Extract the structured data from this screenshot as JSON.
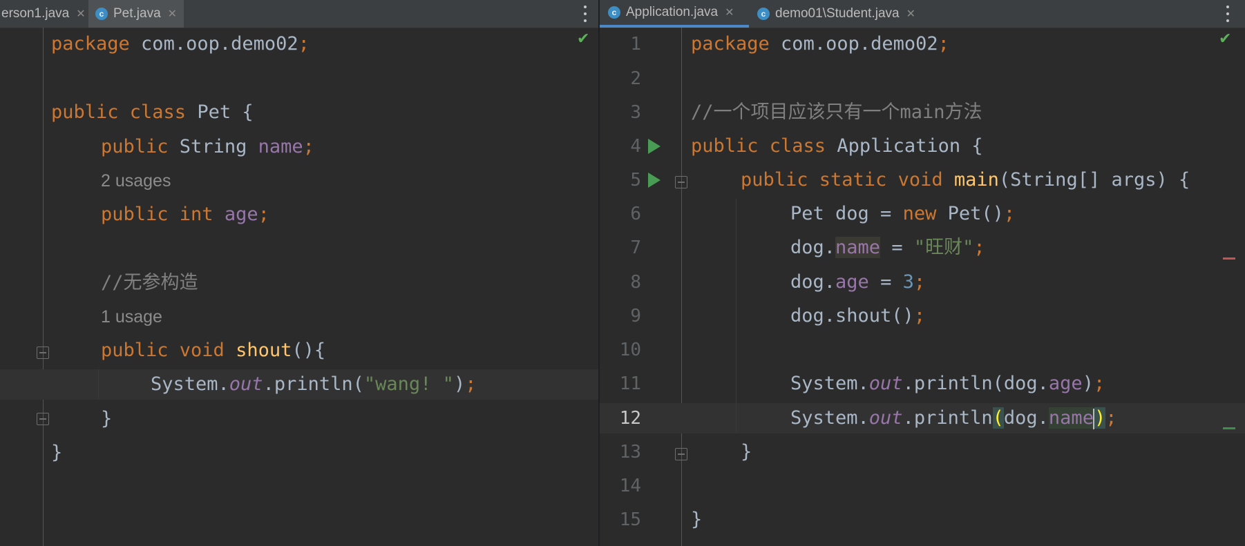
{
  "left_pane": {
    "tabs": [
      {
        "label": "erson1.java",
        "icon": "none"
      },
      {
        "label": "Pet.java",
        "icon": "class-icon"
      }
    ],
    "lines": [
      "package com.oop.demo02;",
      "",
      "public class Pet {",
      "    public String name;",
      "2 usages",
      "    public int age;",
      "",
      "    //无参构造",
      "1 usage",
      "    public void shout(){",
      "        System.out.println(\"wang! \");",
      "    }",
      "}"
    ]
  },
  "right_pane": {
    "tabs": [
      {
        "label": "Application.java",
        "icon": "class-run-icon"
      },
      {
        "label": "demo01\\Student.java",
        "icon": "class-icon"
      }
    ],
    "line_numbers": [
      "1",
      "2",
      "3",
      "4",
      "5",
      "6",
      "7",
      "8",
      "9",
      "10",
      "11",
      "12",
      "13",
      "14",
      "15"
    ],
    "current_line": "12",
    "lines": [
      "package com.oop.demo02;",
      "",
      "//一个项目应该只有一个main方法",
      "public class Application {",
      "    public static void main(String[] args) {",
      "        Pet dog = new Pet();",
      "        dog.name = \"旺财\";",
      "        dog.age = 3;",
      "        dog.shout();",
      "",
      "        System.out.println(dog.age);",
      "        System.out.println(dog.name);",
      "    }",
      "",
      "}"
    ]
  },
  "icons": {
    "class_icon_letter": "c",
    "close": "close-icon",
    "menu": "kebab-menu-icon",
    "inspection_ok": "check-icon",
    "run": "run-gutter-icon",
    "fold": "fold-icon"
  },
  "colors": {
    "background": "#2b2b2b",
    "keyword": "#cc7832",
    "field": "#9876aa",
    "string": "#6a8759",
    "comment": "#808080",
    "method": "#ffc66d",
    "number": "#6897bb",
    "tab_accent": "#4a88c7"
  }
}
